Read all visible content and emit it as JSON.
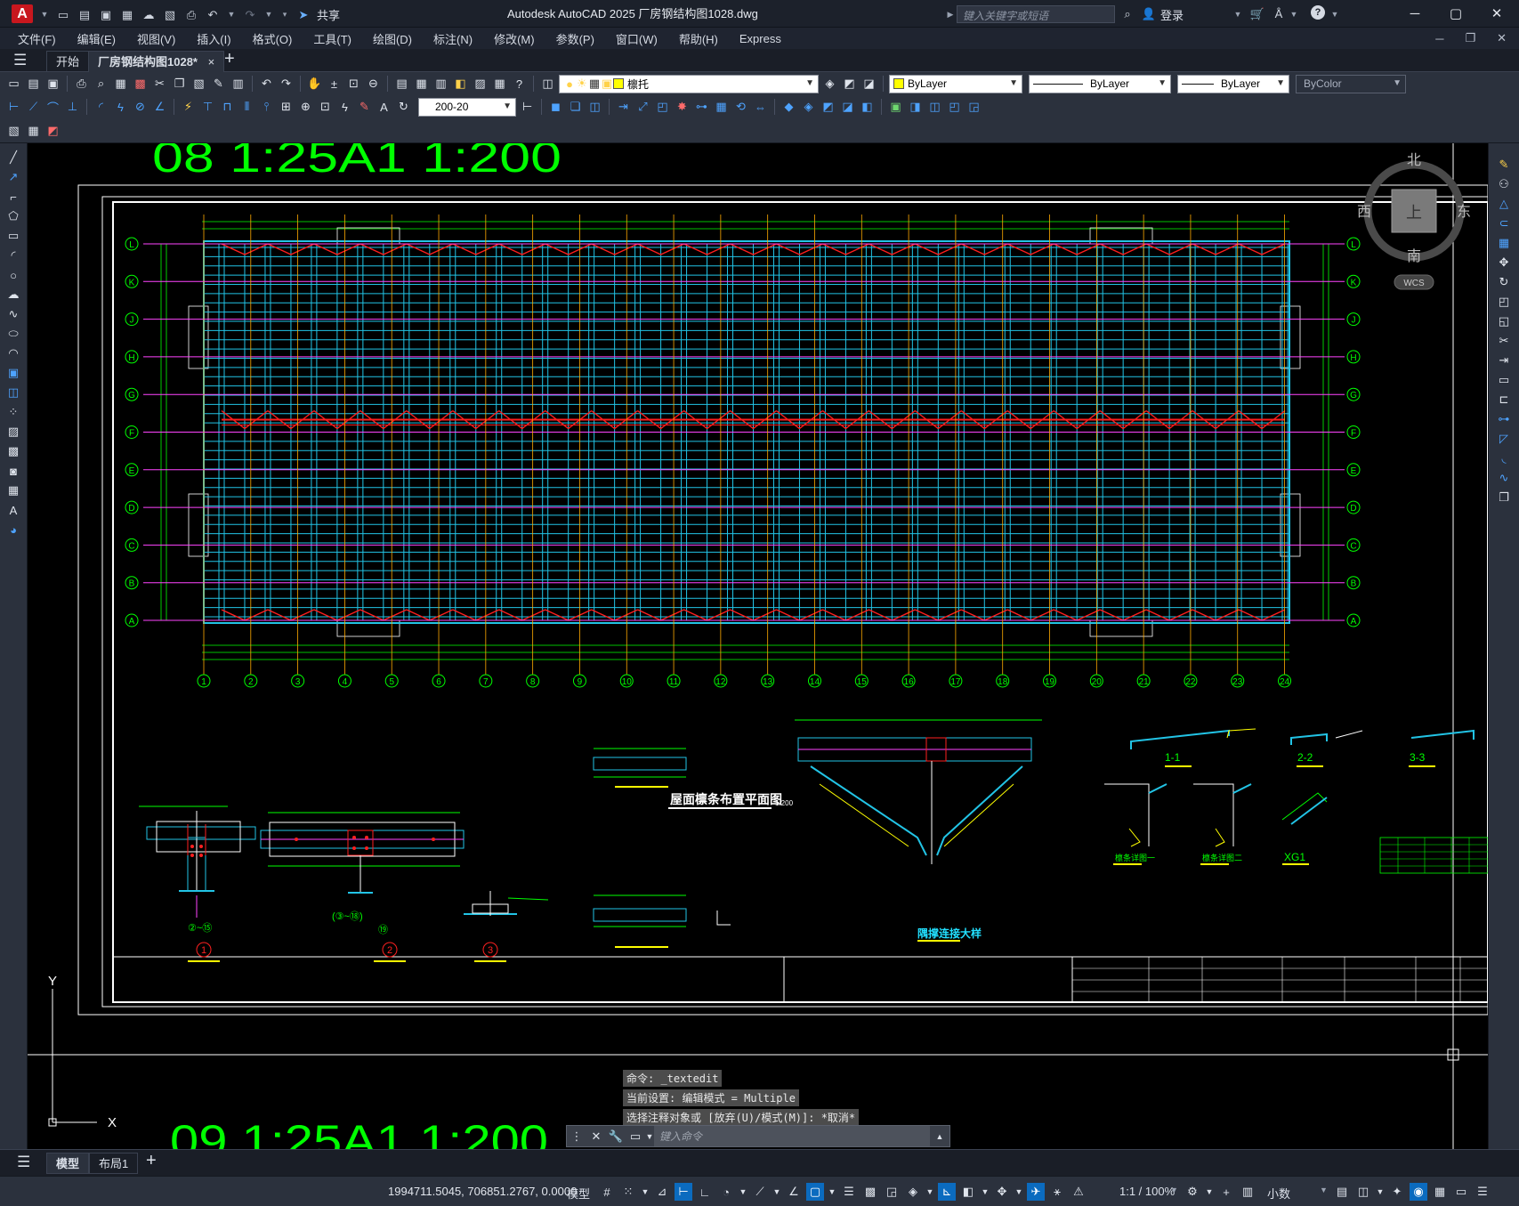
{
  "app": {
    "logo_letter": "A",
    "title": "Autodesk AutoCAD 2025    厂房钢结构图1028.dwg",
    "share_label": "共享",
    "search_placeholder": "键入关键字或短语",
    "login_label": "登录"
  },
  "menu": [
    "文件(F)",
    "编辑(E)",
    "视图(V)",
    "插入(I)",
    "格式(O)",
    "工具(T)",
    "绘图(D)",
    "标注(N)",
    "修改(M)",
    "参数(P)",
    "窗口(W)",
    "帮助(H)",
    "Express"
  ],
  "tabs": {
    "start": "开始",
    "doc": "厂房钢结构图1028*",
    "close_glyph": "×",
    "add_glyph": "+"
  },
  "toolbar": {
    "layer_name": "檩托",
    "color_value": "ByLayer",
    "linetype_value": "ByLayer",
    "lineweight_value": "ByLayer",
    "plotstyle_value": "ByColor",
    "dim_style": "200-20"
  },
  "drawing": {
    "frame_top_label": "08  1:25A1  1:200",
    "frame_bottom_label": "09  1:25A1  1:200",
    "plan_title": "屋面檩条布置平面图",
    "plan_scale": "1:200",
    "row_labels": [
      "L",
      "K",
      "J",
      "H",
      "G",
      "F",
      "E",
      "D",
      "C",
      "B",
      "A"
    ],
    "col_labels": [
      "1",
      "2",
      "3",
      "4",
      "5",
      "6",
      "7",
      "8",
      "9",
      "10",
      "11",
      "12",
      "13",
      "14",
      "15",
      "16",
      "17",
      "18",
      "19",
      "20",
      "21",
      "22",
      "23",
      "24"
    ],
    "detail_labels": [
      "1",
      "2",
      "3"
    ],
    "detail_refs": [
      "②~⑮",
      "(③~⑱)",
      "⑲"
    ],
    "section_labels": [
      "1-1",
      "2-2",
      "3-3"
    ],
    "detail_names": [
      "隅撑连接大样",
      "檩条详图一",
      "檩条详图二",
      "XG1"
    ],
    "ucs": {
      "x": "X",
      "y": "Y"
    }
  },
  "viewcube": {
    "north": "北",
    "south": "南",
    "east": "东",
    "west": "西",
    "top": "上",
    "wcs": "WCS"
  },
  "command": {
    "history": [
      "命令: _textedit",
      "当前设置: 编辑模式 = Multiple",
      "选择注释对象或 [放弃(U)/模式(M)]: *取消*"
    ],
    "placeholder": "键入命令"
  },
  "layouts": {
    "model": "模型",
    "layout1": "布局1",
    "add_glyph": "+"
  },
  "status": {
    "coords": "1994711.5045, 706851.2767, 0.0000",
    "mode": "模型",
    "scale": "1:1 / 100%",
    "units": "小数"
  },
  "colors": {
    "cad_bg": "#000000",
    "purlin": "#22c4e6",
    "bracing": "#ff1e1e",
    "grid": "#ff44ff",
    "dim": "#00ff00",
    "frame": "#ffffff",
    "accent": "#0b6bbf"
  }
}
